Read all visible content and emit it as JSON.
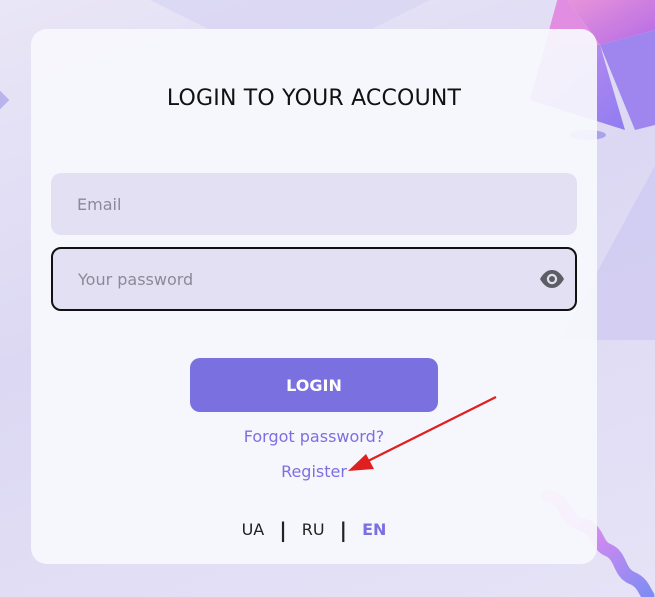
{
  "login_form": {
    "title": "LOGIN TO YOUR ACCOUNT",
    "email_placeholder": "Email",
    "password_placeholder": "Your password",
    "password_toggle_icon": "eye-icon",
    "login_label": "LOGIN",
    "forgot_label": "Forgot password?",
    "register_label": "Register"
  },
  "languages": {
    "items": [
      "UA",
      "RU",
      "EN"
    ],
    "selected": "EN",
    "separator": "|"
  },
  "colors": {
    "accent": "#7b70e0",
    "field_bg": "#e3e0f4",
    "annotation_arrow": "#e02020"
  }
}
